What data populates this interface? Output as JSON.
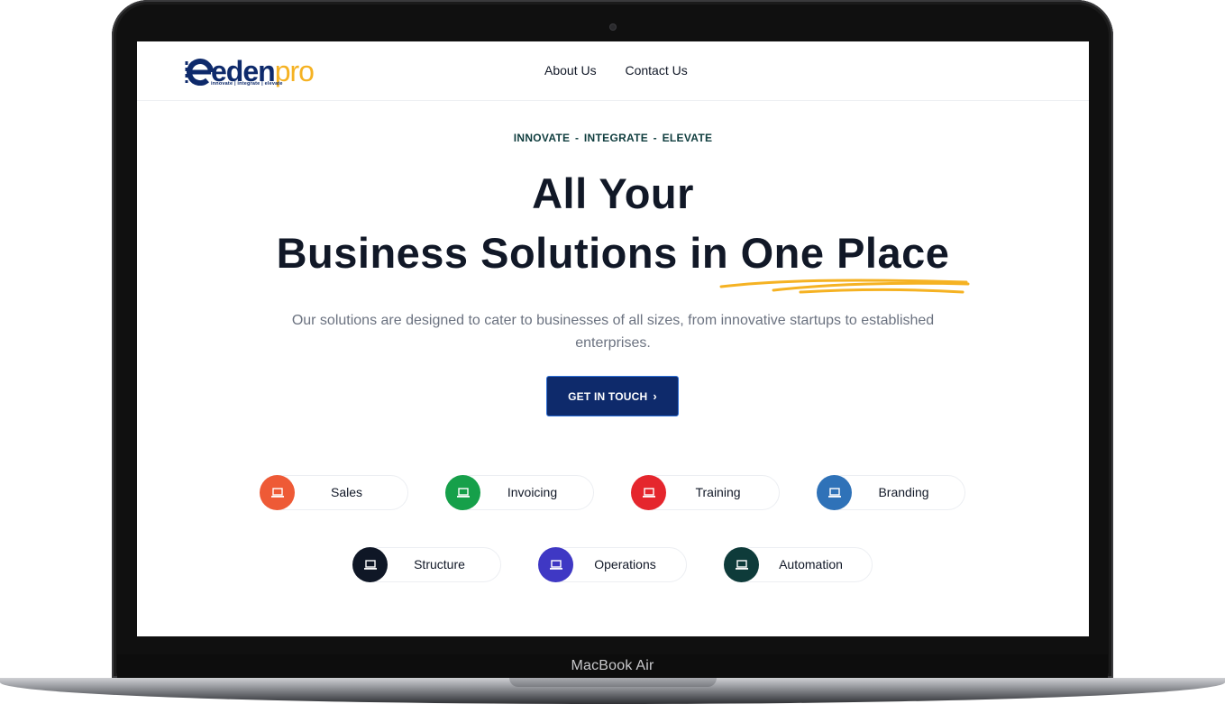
{
  "device": {
    "label": "MacBook Air"
  },
  "logo": {
    "name_main": "eden",
    "name_accent": "pro",
    "tagline": "innovate | integrate | elevate"
  },
  "nav": {
    "items": [
      {
        "label": "About Us"
      },
      {
        "label": "Contact Us"
      }
    ]
  },
  "hero": {
    "tagline": "INNOVATE - INTEGRATE - ELEVATE",
    "title_line1": "All Your",
    "title_line2": "Business Solutions in One Place",
    "subtitle": "Our solutions are designed to cater to businesses of all sizes, from innovative startups to established enterprises.",
    "cta_label": "GET IN TOUCH",
    "cta_icon": "chevron-right-icon"
  },
  "colors": {
    "brand_navy": "#0e2a6b",
    "brand_yellow": "#f5b223",
    "text_dark": "#111827",
    "text_muted": "#6b7280"
  },
  "services": [
    {
      "label": "Sales",
      "color": "#ee5a36",
      "icon": "laptop-icon"
    },
    {
      "label": "Invoicing",
      "color": "#16a04a",
      "icon": "laptop-icon"
    },
    {
      "label": "Training",
      "color": "#e5262d",
      "icon": "laptop-icon"
    },
    {
      "label": "Branding",
      "color": "#2f72b8",
      "icon": "laptop-icon"
    },
    {
      "label": "Structure",
      "color": "#0f1726",
      "icon": "laptop-icon"
    },
    {
      "label": "Operations",
      "color": "#3f38c4",
      "icon": "laptop-icon"
    },
    {
      "label": "Automation",
      "color": "#0e3b3a",
      "icon": "laptop-icon"
    }
  ]
}
